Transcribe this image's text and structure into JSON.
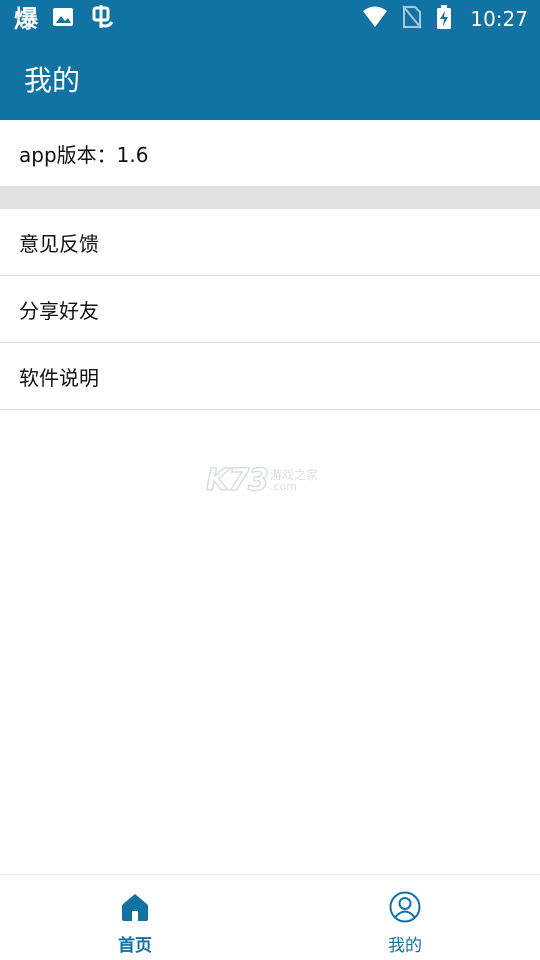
{
  "status_bar": {
    "left_icons": [
      "爆",
      "image-icon",
      "bug-icon"
    ],
    "time": "10:27"
  },
  "app_bar": {
    "title": "我的"
  },
  "content": {
    "version_text": "app版本：1.6",
    "menu_items": [
      {
        "label": "意见反馈"
      },
      {
        "label": "分享好友"
      },
      {
        "label": "软件说明"
      }
    ]
  },
  "watermark": {
    "mark": "K73",
    "top": "游戏之家",
    "bottom": ".com"
  },
  "bottom_nav": {
    "items": [
      {
        "label": "首页",
        "icon": "home-icon",
        "active": true
      },
      {
        "label": "我的",
        "icon": "profile-icon",
        "active": false
      }
    ]
  },
  "colors": {
    "primary": "#1173a4",
    "divider": "#dddddd",
    "band": "#e1e1e1"
  }
}
